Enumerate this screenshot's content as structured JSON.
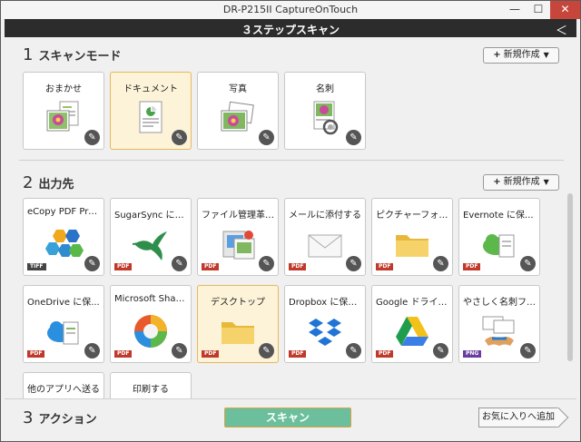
{
  "window": {
    "title": "DR-P215II CaptureOnTouch",
    "minimize": "—",
    "maximize": "☐",
    "close": "✕"
  },
  "header": {
    "title": "３ステップスキャン",
    "back": "＜"
  },
  "section1": {
    "number": "1",
    "label": "スキャンモード",
    "new_button": "新規作成",
    "cards": [
      {
        "label": "おまかせ",
        "icon": "auto-photo-doc-icon",
        "selected": false
      },
      {
        "label": "ドキュメント",
        "icon": "document-icon",
        "selected": true
      },
      {
        "label": "写真",
        "icon": "photo-icon",
        "selected": false
      },
      {
        "label": "名刺",
        "icon": "business-card-icon",
        "selected": false
      }
    ]
  },
  "section2": {
    "number": "2",
    "label": "出力先",
    "new_button": "新規作成",
    "cards": [
      {
        "label": "eCopy PDF Pro...",
        "icon": "ecopy-icon",
        "badge": "TIFF",
        "selected": false
      },
      {
        "label": "SugarSync に保...",
        "icon": "hummingbird-icon",
        "badge": "PDF",
        "selected": false
      },
      {
        "label": "ファイル管理革命L...",
        "icon": "file-manager-icon",
        "badge": "PDF",
        "selected": false
      },
      {
        "label": "メールに添付する",
        "icon": "envelope-icon",
        "badge": "PDF",
        "selected": false
      },
      {
        "label": "ピクチャーフォルダー",
        "icon": "folder-icon",
        "badge": "PDF",
        "selected": false
      },
      {
        "label": "Evernote に保...",
        "icon": "evernote-cloud-icon",
        "badge": "PDF",
        "selected": false
      },
      {
        "label": "OneDrive に保...",
        "icon": "onedrive-cloud-icon",
        "badge": "PDF",
        "selected": false
      },
      {
        "label": "Microsoft Shar...",
        "icon": "sharepoint-icon",
        "badge": "PDF",
        "selected": false
      },
      {
        "label": "デスクトップ",
        "icon": "desktop-folder-icon",
        "badge": "PDF",
        "selected": true
      },
      {
        "label": "Dropbox に保存...",
        "icon": "dropbox-icon",
        "badge": "PDF",
        "selected": false
      },
      {
        "label": "Google ドライブ...",
        "icon": "google-drive-icon",
        "badge": "PDF",
        "selected": false
      },
      {
        "label": "やさしく名刺ファイ...",
        "icon": "handshake-icon",
        "badge": "PNG",
        "selected": false
      },
      {
        "label": "他のアプリへ送る",
        "icon": "",
        "badge": "",
        "selected": false
      },
      {
        "label": "印刷する",
        "icon": "",
        "badge": "",
        "selected": false
      }
    ]
  },
  "section3": {
    "number": "3",
    "label": "アクション",
    "scan_button": "スキャン",
    "favorite_button": "お気に入りへ追加"
  },
  "colors": {
    "accent": "#6cbf9d",
    "selected_bg": "#fdf3d9",
    "selected_border": "#e6b85a",
    "header_bg": "#2c2c2c",
    "pdf_badge": "#c0392b"
  }
}
